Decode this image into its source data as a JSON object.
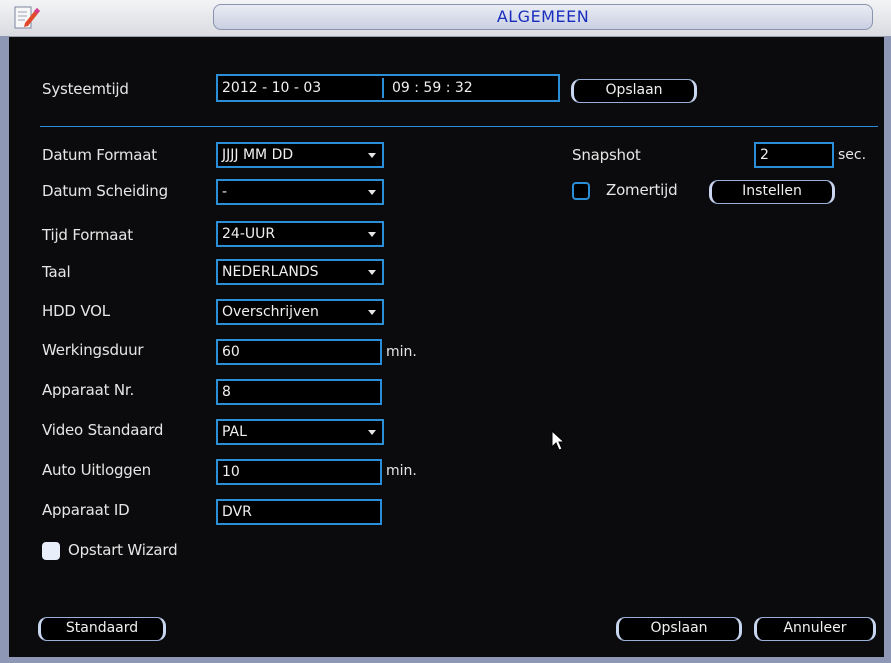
{
  "window": {
    "title": "ALGEMEEN"
  },
  "systemtime": {
    "label": "Systeemtijd",
    "date": "2012  - 10 - 03",
    "time": "09 : 59 : 32",
    "save_label": "Opslaan"
  },
  "left_fields": {
    "datum_formaat": {
      "label": "Datum Formaat",
      "value": "JJJJ MM DD"
    },
    "datum_scheiding": {
      "label": "Datum Scheiding",
      "value": "-"
    },
    "tijd_formaat": {
      "label": "Tijd Formaat",
      "value": "24-UUR"
    },
    "taal": {
      "label": "Taal",
      "value": "NEDERLANDS"
    },
    "hdd_vol": {
      "label": "HDD VOL",
      "value": "Overschrijven"
    },
    "werkingsduur": {
      "label": "Werkingsduur",
      "value": "60",
      "unit": "min."
    },
    "apparaat_nr": {
      "label": "Apparaat Nr.",
      "value": "8"
    },
    "video_standaard": {
      "label": "Video Standaard",
      "value": "PAL"
    },
    "auto_uitloggen": {
      "label": "Auto Uitloggen",
      "value": "10",
      "unit": "min."
    },
    "apparaat_id": {
      "label": "Apparaat ID",
      "value": "DVR"
    }
  },
  "opstart_wizard": {
    "label": "Opstart Wizard",
    "checked": true
  },
  "snapshot": {
    "label": "Snapshot",
    "value": "2",
    "unit": "sec."
  },
  "zomertijd": {
    "label": "Zomertijd",
    "checked": false,
    "button_label": "Instellen"
  },
  "footer": {
    "default_label": "Standaard",
    "save_label": "Opslaan",
    "cancel_label": "Annuleer"
  },
  "colors": {
    "accent": "#2a8fd6",
    "title_text": "#1a2dbd",
    "background": "#0b0b0d"
  }
}
